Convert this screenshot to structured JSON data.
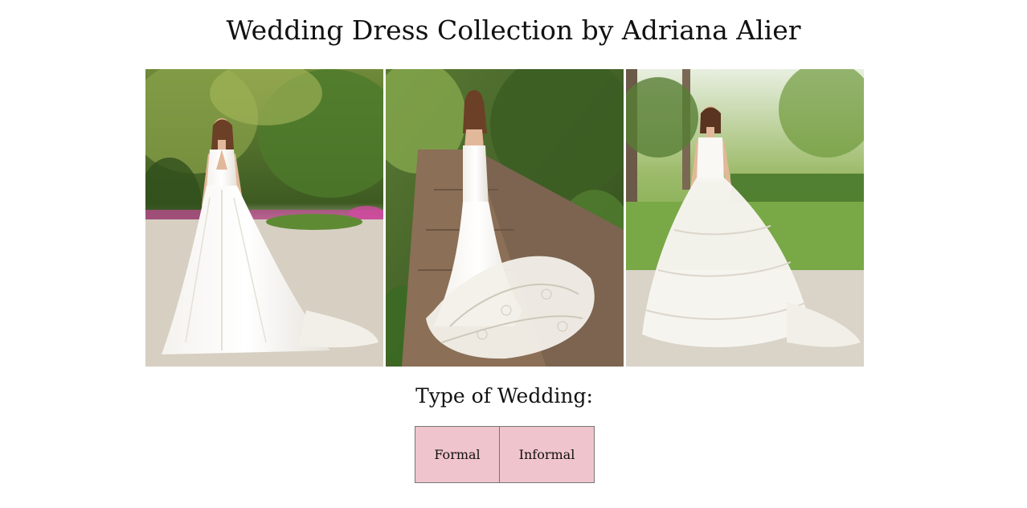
{
  "page": {
    "title": "Wedding Dress Collection by Adriana Alier",
    "subtitle": "Type of Wedding:"
  },
  "gallery": {
    "photos": [
      {
        "icon": "wedding-dress-photo"
      },
      {
        "icon": "wedding-dress-photo"
      },
      {
        "icon": "wedding-dress-photo"
      }
    ]
  },
  "buttons": {
    "formal_label": "Formal",
    "informal_label": "Informal"
  },
  "colors": {
    "button_bg": "#f0c4cc",
    "button_border": "#777777",
    "background": "#ffffff",
    "text": "#111111"
  }
}
